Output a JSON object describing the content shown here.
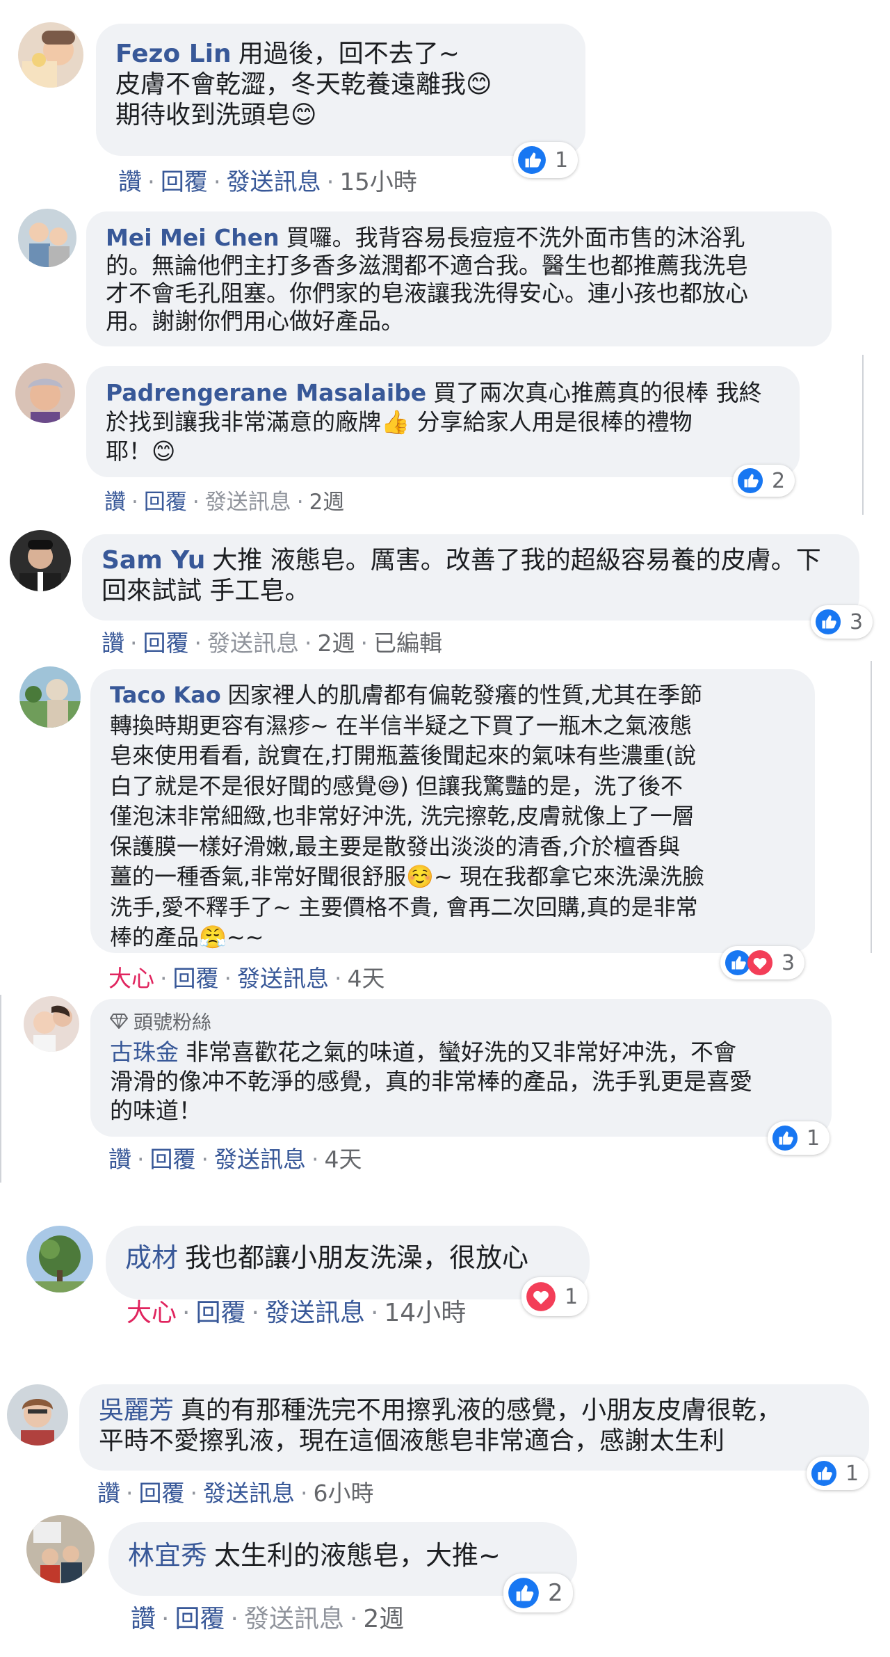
{
  "comments": [
    {
      "name": "Fezo Lin",
      "lines": [
        "用過後，回不去了~",
        "皮膚不會乾澀，冬天乾養遠離我😊",
        "期待收到洗頭皂😊"
      ],
      "actions": [
        "讚",
        "回覆",
        "發送訊息",
        "15小時"
      ],
      "reaction_count": "1",
      "reactions": [
        "like"
      ]
    },
    {
      "name": "Mei Mei Chen",
      "lines": [
        "買囉。我背容易長痘痘不洗外面市售的沐浴乳",
        "的。無論他們主打多香多滋潤都不適合我。醫生也都推薦我洗皂",
        "才不會毛孔阻塞。你們家的皂液讓我洗得安心。連小孩也都放心",
        "用。謝謝你們用心做好產品。"
      ],
      "actions": []
    },
    {
      "name": "Padrengerane Masalaibe",
      "lines": [
        "買了兩次真心推薦真的很棒 我終",
        "於找到讓我非常滿意的廠牌👍 分享給家人用是很棒的禮物",
        "耶！😊"
      ],
      "actions": [
        "讚",
        "回覆",
        "發送訊息",
        "2週"
      ],
      "reaction_count": "2",
      "reactions": [
        "like"
      ]
    },
    {
      "name": "Sam Yu",
      "lines": [
        "大推 液態皂。厲害。改善了我的超級容易養的皮膚。下",
        "回來試試 手工皂。"
      ],
      "actions": [
        "讚",
        "回覆",
        "發送訊息",
        "2週",
        "已編輯"
      ],
      "reaction_count": "3",
      "reactions": [
        "like"
      ]
    },
    {
      "name": "Taco Kao",
      "lines": [
        "因家裡人的肌膚都有偏乾發癢的性質,尤其在季節",
        "轉換時期更容有濕疹~ 在半信半疑之下買了一瓶木之氣液態",
        "皂來使用看看, 說實在,打開瓶蓋後聞起來的氣味有些濃重(說",
        "白了就是不是很好聞的感覺😅) 但讓我驚豔的是，洗了後不",
        "僅泡沫非常細緻,也非常好沖洗, 洗完擦乾,皮膚就像上了一層",
        "保護膜一樣好滑嫩,最主要是散發出淡淡的清香,介於檀香與",
        "薑的一種香氣,非常好聞很舒服☺️~ 現在我都拿它來洗澡洗臉",
        "洗手,愛不釋手了~ 主要價格不貴, 會再二次回購,真的是非常",
        "棒的產品😤~~"
      ],
      "actions": [
        "大心",
        "回覆",
        "發送訊息",
        "4天"
      ],
      "reaction_count": "3",
      "reactions": [
        "like",
        "love"
      ]
    },
    {
      "badge": "頭號粉絲",
      "name": "古珠金",
      "lines": [
        "非常喜歡花之氣的味道，蠻好洗的又非常好冲洗，不會",
        "滑滑的像冲不乾淨的感覺，真的非常棒的產品，洗手乳更是喜愛",
        "的味道！"
      ],
      "actions": [
        "讚",
        "回覆",
        "發送訊息",
        "4天"
      ],
      "reaction_count": "1",
      "reactions": [
        "like"
      ]
    },
    {
      "name": "成材",
      "lines": [
        "我也都讓小朋友洗澡，很放心"
      ],
      "actions": [
        "大心",
        "回覆",
        "發送訊息",
        "14小時"
      ],
      "reaction_count": "1",
      "reactions": [
        "love"
      ]
    },
    {
      "name": "吳麗芳",
      "lines": [
        "真的有那種洗完不用擦乳液的感覺，小朋友皮膚很乾，",
        "平時不愛擦乳液，現在這個液態皂非常適合，感謝太生利"
      ],
      "actions": [
        "讚",
        "回覆",
        "發送訊息",
        "6小時"
      ],
      "reaction_count": "1",
      "reactions": [
        "like"
      ]
    },
    {
      "name": "林宜秀",
      "lines": [
        "太生利的液態皂，大推~"
      ],
      "actions": [
        "讚",
        "回覆",
        "發送訊息",
        "2週"
      ],
      "reaction_count": "2",
      "reactions": [
        "like"
      ]
    }
  ],
  "colors": {
    "name": "#385898",
    "bubble": "#f0f2f5",
    "meta": "#65676b",
    "like": "#1877f2",
    "love": "#f33e58"
  }
}
